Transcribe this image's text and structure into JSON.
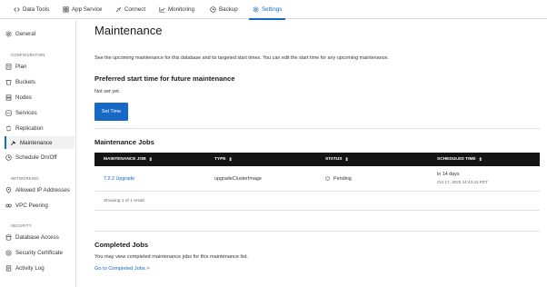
{
  "topnav": {
    "tabs": [
      {
        "label": "Data Tools",
        "icon": "code-icon"
      },
      {
        "label": "App Service",
        "icon": "app-service-icon"
      },
      {
        "label": "Connect",
        "icon": "connect-icon"
      },
      {
        "label": "Monitoring",
        "icon": "chart-icon"
      },
      {
        "label": "Backup",
        "icon": "clock-icon"
      },
      {
        "label": "Settings",
        "icon": "gear-icon",
        "active": true
      }
    ]
  },
  "sidebar": {
    "general": "General",
    "sections": {
      "configuration": "CONFIGURATION",
      "networking": "NETWORKING",
      "security": "SECURITY"
    },
    "configuration_items": [
      "Plan",
      "Buckets",
      "Nodes",
      "Services",
      "Replication",
      "Maintenance",
      "Schedule On/Off"
    ],
    "networking_items": [
      "Allowed IP Addresses",
      "VPC Peering"
    ],
    "security_items": [
      "Database Access",
      "Security Certificate",
      "Activity Log"
    ],
    "active_item": "Maintenance"
  },
  "main": {
    "title": "Maintenance",
    "description": "See the upcoming maintenance for this database and its targeted start times. You can edit the start time for any upcoming maintenance.",
    "preferred": {
      "title": "Preferred start time for future maintenance",
      "value": "Not set yet.",
      "button": "Set Time"
    },
    "jobs": {
      "title": "Maintenance Jobs",
      "columns": [
        "MAINTENANCE JOB",
        "TYPE",
        "STATUS",
        "SCHEDULED TIME"
      ],
      "rows": [
        {
          "job": "7.2.2 Upgrade",
          "type": "upgradeClusterImage",
          "status": "Pending",
          "scheduled": "in 14 days",
          "scheduled_detail": "Oct 17, 2023 14:43:41 PDT"
        }
      ],
      "showing": "Showing 1 of 1 result"
    },
    "completed": {
      "title": "Completed Jobs",
      "description": "You may view completed maintenance jobs for this maintenance list.",
      "link": "Go to Completed Jobs >"
    }
  },
  "colors": {
    "accent": "#1569c4",
    "table_header": "#141414"
  }
}
